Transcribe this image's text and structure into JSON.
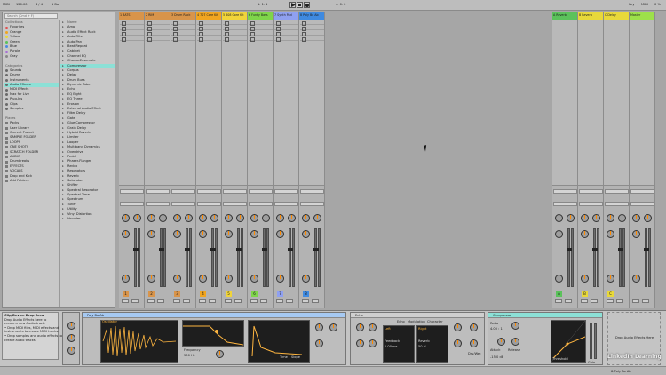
{
  "transport": {
    "tempo": "120.00",
    "time_sig": "4 / 4",
    "quantize": "1 Bar",
    "position": "1. 1. 1",
    "loop_end": "4. 0. 0",
    "key_label": "Key",
    "midi_label": "MIDI",
    "cpu": "0 %"
  },
  "browser": {
    "search_placeholder": "Search (Cmd + F)",
    "collections_header": "Collections",
    "collections": [
      {
        "label": "Favorites",
        "color": "#e34a4a"
      },
      {
        "label": "Orange",
        "color": "#f0a520"
      },
      {
        "label": "Yellow",
        "color": "#e8d83a"
      },
      {
        "label": "Green",
        "color": "#5bc25b"
      },
      {
        "label": "Blue",
        "color": "#4a8ae0"
      },
      {
        "label": "Purple",
        "color": "#a66bd6"
      },
      {
        "label": "Gray",
        "color": "#888888"
      }
    ],
    "categories_header": "Categories",
    "categories": [
      "Sounds",
      "Drums",
      "Instruments",
      "Audio Effects",
      "MIDI Effects",
      "Max for Live",
      "Plug-Ins",
      "Clips",
      "Samples"
    ],
    "selected_category": "Audio Effects",
    "places_header": "Places",
    "places": [
      "Packs",
      "User Library",
      "Current Project",
      "SAMPLE FOLDER",
      "LOOPS",
      "ONE SHOTS",
      "SCRATCH FOLDER",
      "AUDIO",
      "Drumbreaks",
      "EFFECTS",
      "VOCALS",
      "Drop and Kick",
      "Add Folder..."
    ],
    "name_header": "Name",
    "items": [
      "Amp",
      "Audio Effect Rack",
      "Auto Filter",
      "Auto Pan",
      "Beat Repeat",
      "Cabinet",
      "Channel EQ",
      "Chorus-Ensemble",
      "Compressor",
      "Corpus",
      "Delay",
      "Drum Buss",
      "Dynamic Tube",
      "Echo",
      "EQ Eight",
      "EQ Three",
      "Erosion",
      "External Audio Effect",
      "Filter Delay",
      "Gate",
      "Glue Compressor",
      "Grain Delay",
      "Hybrid Reverb",
      "Limiter",
      "Looper",
      "Multiband Dynamics",
      "Overdrive",
      "Pedal",
      "Phaser-Flanger",
      "Redux",
      "Resonators",
      "Reverb",
      "Saturator",
      "Shifter",
      "Spectral Resonator",
      "Spectral Time",
      "Spectrum",
      "Tuner",
      "Utility",
      "Vinyl Distortion",
      "Vocoder"
    ],
    "selected_item": "Compressor"
  },
  "tracks": [
    {
      "name": "1 BATS",
      "color": "#d8944a",
      "num": "1"
    },
    {
      "name": "2 RIM",
      "color": "#d8944a",
      "num": "2"
    },
    {
      "name": "3 Drum Rack",
      "color": "#d8944a",
      "num": "3"
    },
    {
      "name": "4 707 Core Kit",
      "color": "#f0a520",
      "num": "4"
    },
    {
      "name": "5 808 Core Kit",
      "color": "#f0d43a",
      "num": "5"
    },
    {
      "name": "6 Funky Bass",
      "color": "#7fd54a",
      "num": "6"
    },
    {
      "name": "7 Synth Pad",
      "color": "#8fa0f0",
      "num": "7"
    },
    {
      "name": "8 Poly Bo Ab",
      "color": "#3f8ae0",
      "num": "8"
    }
  ],
  "returns": [
    {
      "name": "A Reverb",
      "color": "#5bc25b",
      "num": "A"
    },
    {
      "name": "B Reverb",
      "color": "#e8d83a",
      "num": "B"
    },
    {
      "name": "C Delay",
      "color": "#e8d83a",
      "num": "C"
    },
    {
      "name": "Master",
      "color": "#9de04a",
      "num": ""
    }
  ],
  "help": {
    "title": "Clip/Device Drop Area",
    "lines": [
      "Drop Audio Effects here to",
      "create a new Audio track.",
      "• Drop MIDI files, MIDI effects and",
      "  instruments to create MIDI tracks.",
      "• Drop samples and audio effects to",
      "  create audio tracks."
    ]
  },
  "devices": {
    "poly": {
      "title": "Poly Bo Ab",
      "label_osc": "Oscillator",
      "label_filter": "Filter",
      "label_env": "Envelope",
      "freq_label": "Frequency",
      "freq_value": "500 Hz",
      "res_label": "Res",
      "time_label": "Time",
      "slope_label": "Slope"
    },
    "echo": {
      "title": "Echo",
      "tab_echo": "Echo",
      "tab_mod": "Modulation",
      "tab_char": "Character",
      "left_label": "Left",
      "right_label": "Right",
      "feedback": "Feedback",
      "reverb": "Reverb",
      "stereo": "Stereo",
      "dry_wet": "Dry/Wet",
      "value1": "50 %",
      "value2": "1.00 ms"
    },
    "compressor": {
      "title": "Compressor",
      "ratio": "Ratio",
      "attack": "Attack",
      "release": "Release",
      "threshold": "Threshold",
      "gain": "Gain",
      "dry_wet": "Dry/Wet",
      "ratio_value": "4.00 : 1",
      "threshold_value": "-15.0 dB"
    },
    "drop_hint": "Drop Audio Effects Here"
  },
  "status": {
    "left": "",
    "right": "8-Poly Bo Ab"
  },
  "watermark": "LinkedIn Learning"
}
